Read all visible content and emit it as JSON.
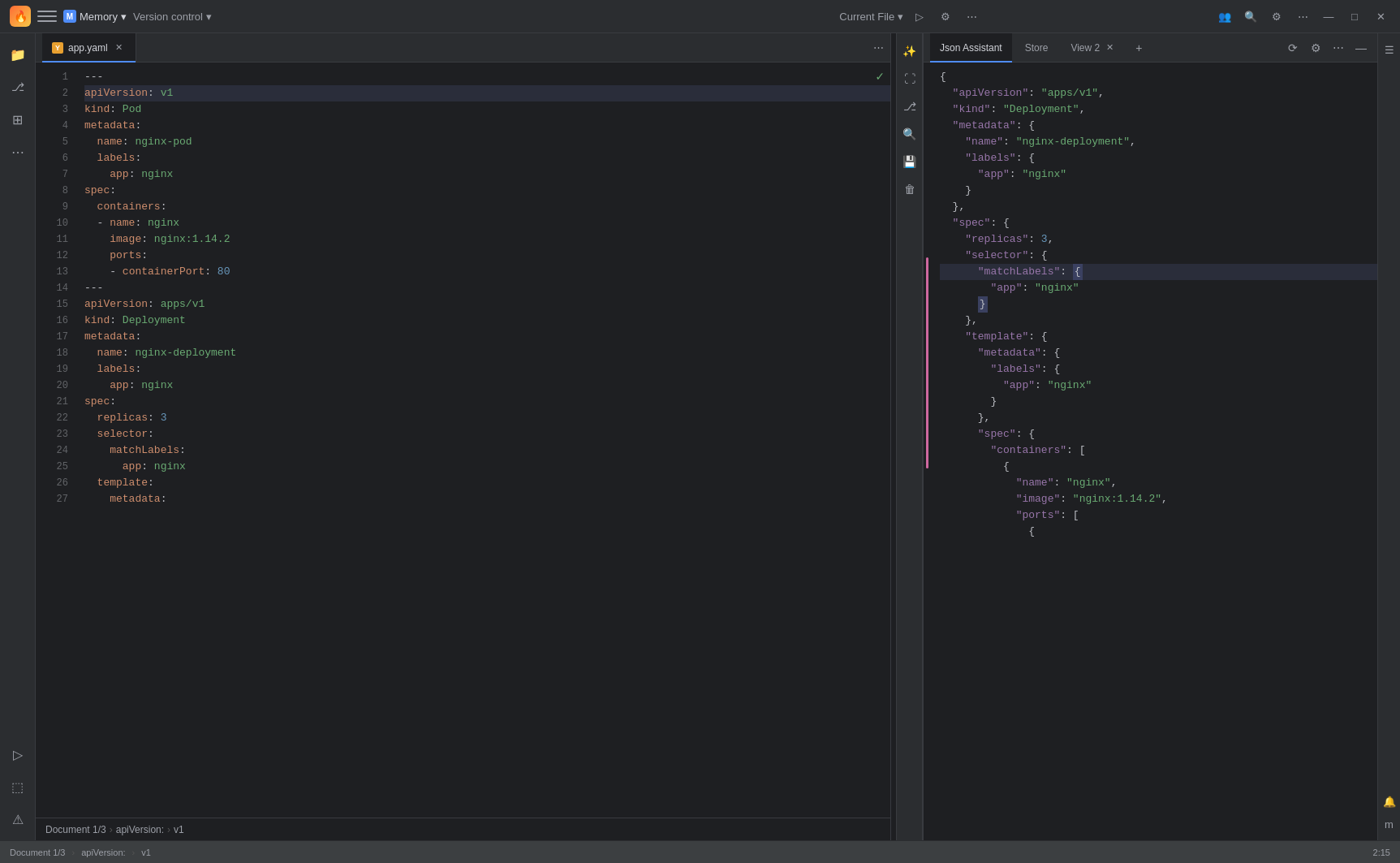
{
  "titlebar": {
    "app_name": "Memory",
    "version_control": "Version control",
    "current_file": "Current File",
    "chevron": "▾"
  },
  "tabs": {
    "editor_tab": "app.yaml",
    "json_assistant": "Json Assistant",
    "store": "Store",
    "view2": "View 2"
  },
  "breadcrumb": {
    "document": "Document 1/3",
    "separator1": "›",
    "item1": "apiVersion:",
    "separator2": "›",
    "item2": "v1"
  },
  "yaml_lines": [
    {
      "num": 1,
      "content": "---",
      "type": "separator"
    },
    {
      "num": 2,
      "content": "apiVersion: v1",
      "type": "keyval",
      "key": "apiVersion",
      "val": "v1",
      "highlighted": true
    },
    {
      "num": 3,
      "content": "kind: Pod",
      "type": "keyval",
      "key": "kind",
      "val": "Pod"
    },
    {
      "num": 4,
      "content": "metadata:",
      "type": "key"
    },
    {
      "num": 5,
      "content": "  name: nginx-pod",
      "type": "keyval",
      "indent": 2,
      "key": "name",
      "val": "nginx-pod"
    },
    {
      "num": 6,
      "content": "  labels:",
      "type": "key",
      "indent": 2
    },
    {
      "num": 7,
      "content": "    app: nginx",
      "type": "keyval",
      "indent": 4,
      "key": "app",
      "val": "nginx"
    },
    {
      "num": 8,
      "content": "spec:",
      "type": "key"
    },
    {
      "num": 9,
      "content": "  containers:",
      "type": "key",
      "indent": 2
    },
    {
      "num": 10,
      "content": "  - name: nginx",
      "type": "keyval",
      "indent": 2,
      "key": "name",
      "val": "nginx"
    },
    {
      "num": 11,
      "content": "    image: nginx:1.14.2",
      "type": "keyval",
      "indent": 4,
      "key": "image",
      "val": "nginx:1.14.2"
    },
    {
      "num": 12,
      "content": "    ports:",
      "type": "key",
      "indent": 4
    },
    {
      "num": 13,
      "content": "    - containerPort: 80",
      "type": "keyval",
      "indent": 4,
      "key": "containerPort",
      "val": "80"
    },
    {
      "num": 14,
      "content": "---",
      "type": "separator"
    },
    {
      "num": 15,
      "content": "apiVersion: apps/v1",
      "type": "keyval",
      "key": "apiVersion",
      "val": "apps/v1"
    },
    {
      "num": 16,
      "content": "kind: Deployment",
      "type": "keyval",
      "key": "kind",
      "val": "Deployment"
    },
    {
      "num": 17,
      "content": "metadata:",
      "type": "key"
    },
    {
      "num": 18,
      "content": "  name: nginx-deployment",
      "type": "keyval",
      "indent": 2,
      "key": "name",
      "val": "nginx-deployment"
    },
    {
      "num": 19,
      "content": "  labels:",
      "type": "key",
      "indent": 2
    },
    {
      "num": 20,
      "content": "    app: nginx",
      "type": "keyval",
      "indent": 4,
      "key": "app",
      "val": "nginx"
    },
    {
      "num": 21,
      "content": "spec:",
      "type": "key"
    },
    {
      "num": 22,
      "content": "  replicas: 3",
      "type": "keyval",
      "indent": 2,
      "key": "replicas",
      "val": "3"
    },
    {
      "num": 23,
      "content": "  selector:",
      "type": "key",
      "indent": 2
    },
    {
      "num": 24,
      "content": "    matchLabels:",
      "type": "key",
      "indent": 4
    },
    {
      "num": 25,
      "content": "      app: nginx",
      "type": "keyval",
      "indent": 6,
      "key": "app",
      "val": "nginx"
    },
    {
      "num": 26,
      "content": "  template:",
      "type": "key",
      "indent": 2
    },
    {
      "num": 27,
      "content": "    metadata:",
      "type": "key",
      "indent": 4
    }
  ],
  "json_lines": [
    {
      "content": "{"
    },
    {
      "content": "  \"apiVersion\": \"apps/v1\",",
      "key": "apiVersion",
      "val": "apps/v1"
    },
    {
      "content": "  \"kind\": \"Deployment\",",
      "key": "kind",
      "val": "Deployment"
    },
    {
      "content": "  \"metadata\": {",
      "key": "metadata"
    },
    {
      "content": "    \"name\": \"nginx-deployment\",",
      "key": "name",
      "val": "nginx-deployment"
    },
    {
      "content": "    \"labels\": {",
      "key": "labels"
    },
    {
      "content": "      \"app\": \"nginx\"",
      "key": "app",
      "val": "nginx"
    },
    {
      "content": "    }"
    },
    {
      "content": "  },"
    },
    {
      "content": "  \"spec\": {",
      "key": "spec"
    },
    {
      "content": "    \"replicas\": 3,",
      "key": "replicas",
      "val": "3"
    },
    {
      "content": "    \"selector\": {",
      "key": "selector"
    },
    {
      "content": "      \"matchLabels\": {",
      "key": "matchLabels",
      "highlighted": true
    },
    {
      "content": "        \"app\": \"nginx\"",
      "key": "app",
      "val": "nginx"
    },
    {
      "content": "      }",
      "close": true,
      "highlighted_bracket": true
    },
    {
      "content": "    },"
    },
    {
      "content": "    \"template\": {",
      "key": "template"
    },
    {
      "content": "      \"metadata\": {",
      "key": "metadata"
    },
    {
      "content": "        \"labels\": {",
      "key": "labels"
    },
    {
      "content": "          \"app\": \"nginx\"",
      "key": "app",
      "val": "nginx"
    },
    {
      "content": "        }"
    },
    {
      "content": "      },"
    },
    {
      "content": "      \"spec\": {",
      "key": "spec"
    },
    {
      "content": "        \"containers\": [",
      "key": "containers"
    },
    {
      "content": "          {"
    },
    {
      "content": "            \"name\": \"nginx\",",
      "key": "name",
      "val": "nginx"
    },
    {
      "content": "            \"image\": \"nginx:1.14.2\",",
      "key": "image",
      "val": "nginx:1.14.2"
    },
    {
      "content": "            \"ports\": [",
      "key": "ports"
    },
    {
      "content": "              {"
    }
  ],
  "status": {
    "document_info": "Document 1/3",
    "breadcrumb1": "apiVersion:",
    "breadcrumb2": "v1",
    "line_col": "2:15"
  }
}
